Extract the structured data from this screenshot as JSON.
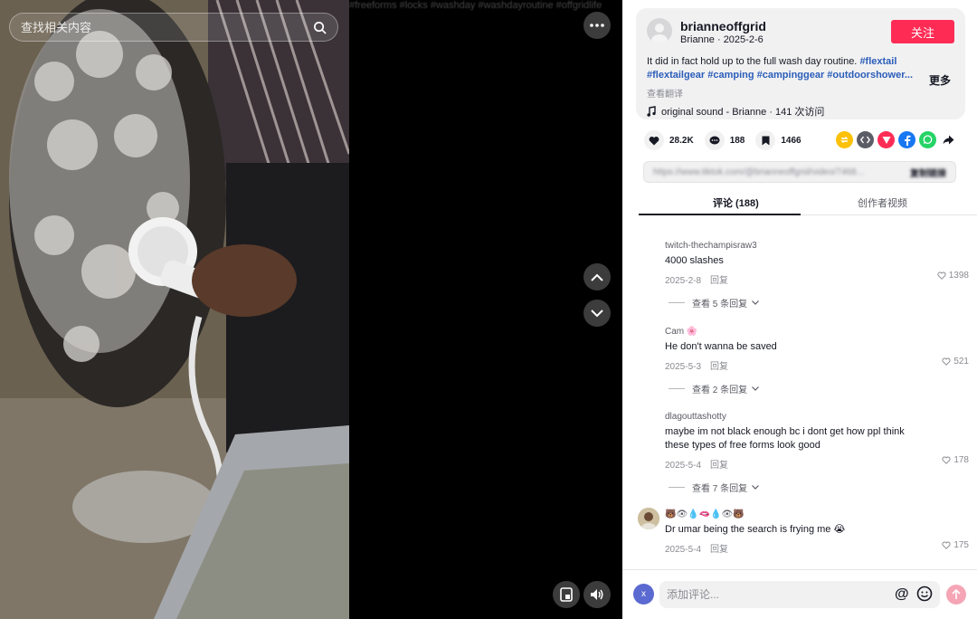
{
  "video": {
    "hashtags_overlay": "#freeforms #locks #washday #washdayroutine #offgridlife"
  },
  "search": {
    "placeholder": "查找相关内容",
    "icon": "search-icon"
  },
  "controls": {
    "more_icon": "more-dots-icon",
    "prev_icon": "chevron-up-icon",
    "next_icon": "chevron-down-icon",
    "pip_icon": "picture-in-picture-icon",
    "volume_icon": "volume-icon"
  },
  "author": {
    "username": "brianneoffgrid",
    "display_name": "Brianne",
    "date": "2025-2-6",
    "meta": "Brianne · 2025-2-6",
    "follow_label": "关注"
  },
  "description": {
    "text": "It did in fact hold up to the full wash day routine.",
    "tags_line1": "#flextail",
    "tags_line2": "#flextailgear #camping #campinggear #outdoorshower...",
    "translate": "查看翻译",
    "more": "更多"
  },
  "music": {
    "text": "original sound - Brianne · 141 次访问"
  },
  "actions": {
    "likes": "28.2K",
    "comments": "188",
    "saves": "1466"
  },
  "share_icons": [
    "repost-icon",
    "embed-icon",
    "direct-send-icon",
    "facebook-icon",
    "whatsapp-icon",
    "share-arrow-icon"
  ],
  "link": {
    "url": "https://www.tiktok.com/@brianneoffgrid/video/7468...",
    "copy_label": "复制链接"
  },
  "tabs": {
    "comments": "评论 (188)",
    "creator": "创作者视频"
  },
  "comments": [
    {
      "user": "twitch-thechampisraw3",
      "text": "4000 slashes",
      "date": "2025-2-8",
      "reply": "回复",
      "likes": "1398",
      "replies": "查看 5 条回复"
    },
    {
      "user": "Cam 🌸",
      "text": "He don't wanna be saved",
      "date": "2025-5-3",
      "reply": "回复",
      "likes": "521",
      "replies": "查看 2 条回复"
    },
    {
      "user": "dlagouttashotty",
      "text": "maybe im not black enough bc i dont get how ppl think these types of free forms look good",
      "date": "2025-5-4",
      "reply": "回复",
      "likes": "178",
      "replies": "查看 7 条回复"
    },
    {
      "user": "🐻👁💧🫦💧👁🐻",
      "text": "Dr umar being the search is frying me 😭",
      "date": "2025-5-4",
      "reply": "回复",
      "likes": "175"
    }
  ],
  "comment_bar": {
    "me_initial": "x",
    "placeholder": "添加评论...",
    "at": "@"
  },
  "colors": {
    "brand_red": "#fe2c55",
    "hashtag_blue": "#2b5db9"
  }
}
